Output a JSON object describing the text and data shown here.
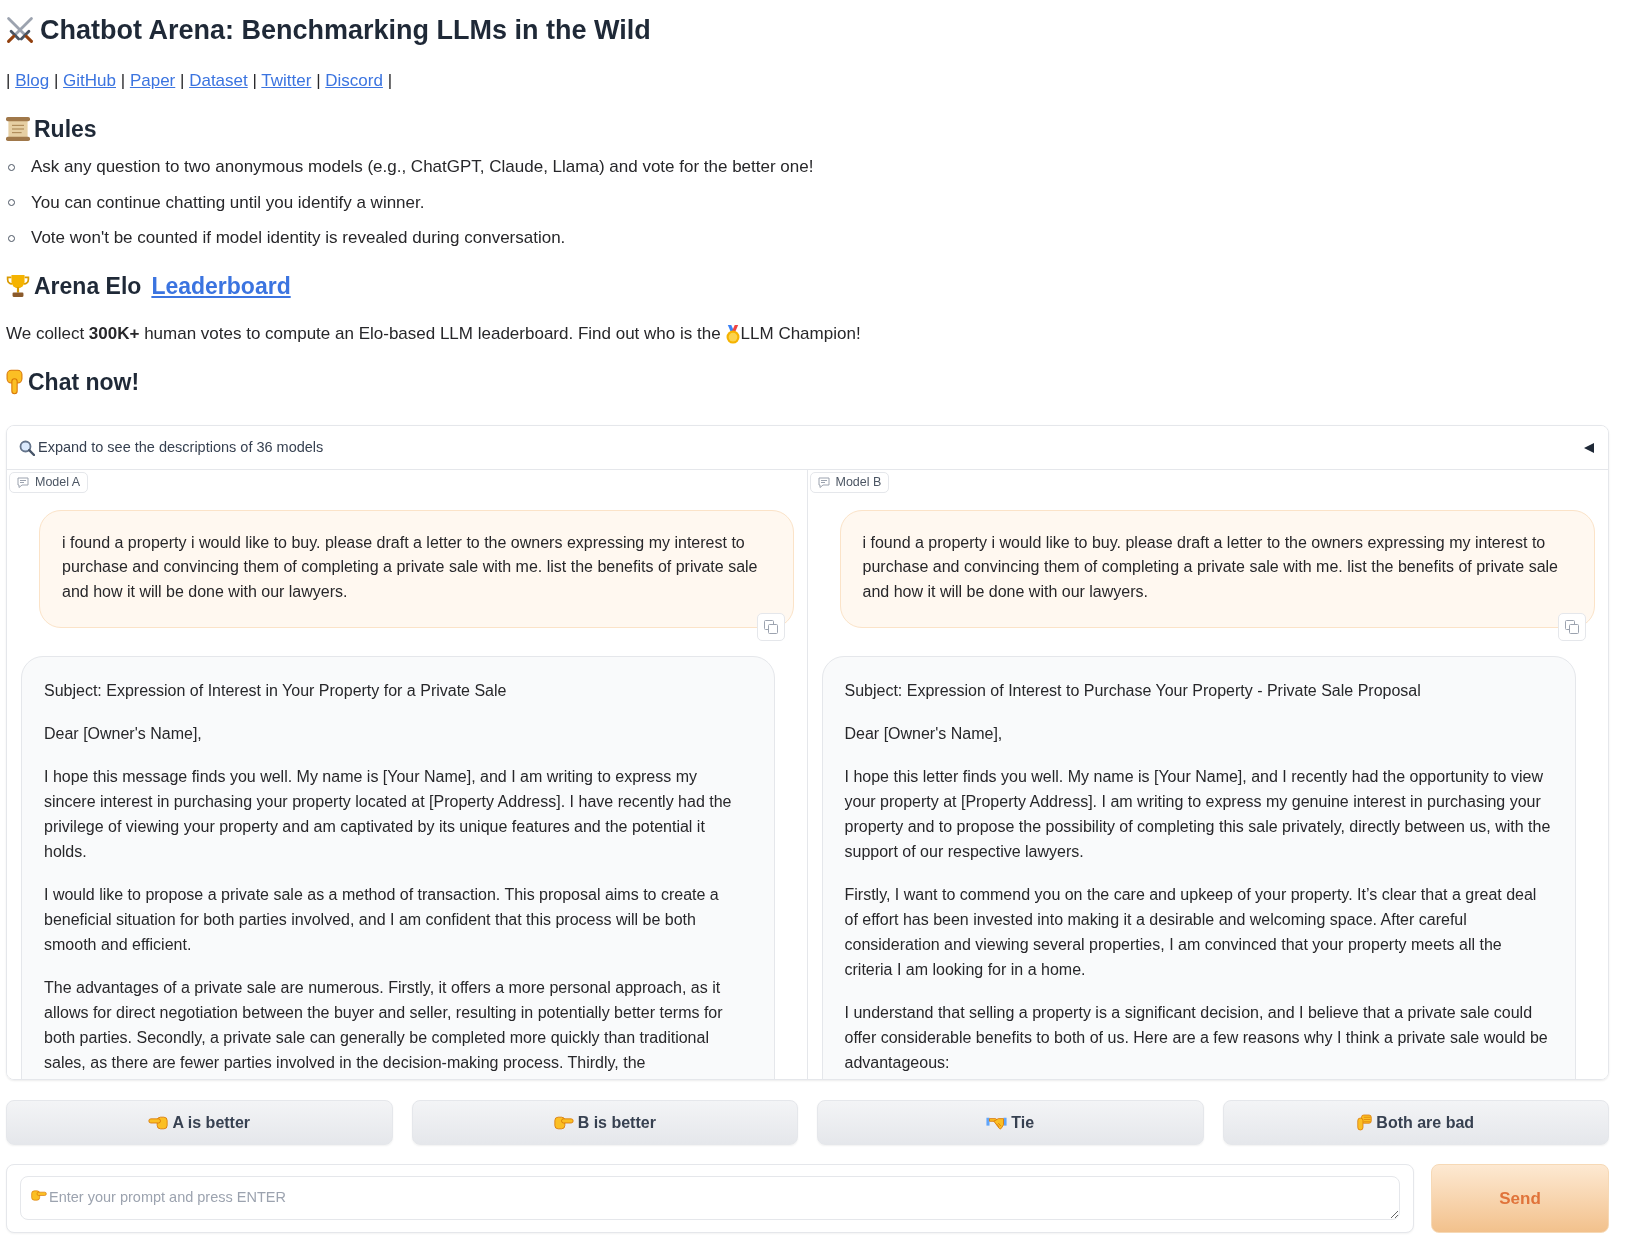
{
  "header": {
    "title": "Chatbot Arena: Benchmarking LLMs in the Wild"
  },
  "links_bar": {
    "separator": "|",
    "links": [
      "Blog",
      "GitHub",
      "Paper",
      "Dataset",
      "Twitter",
      "Discord"
    ]
  },
  "rules": {
    "heading": "Rules",
    "items": [
      "Ask any question to two anonymous models (e.g., ChatGPT, Claude, Llama) and vote for the better one!",
      "You can continue chatting until you identify a winner.",
      "Vote won't be counted if model identity is revealed during conversation."
    ]
  },
  "leaderboard": {
    "heading": "Arena Elo",
    "link": "Leaderboard",
    "text_before": "We collect **300K+** human votes to compute an Elo-based LLM leaderboard. Find out who is the",
    "text_after": "LLM Champion!"
  },
  "chat_heading": "Chat now!",
  "models_accordion": {
    "label": "Expand to see the descriptions of 36 models",
    "expanded": false
  },
  "chat_panels": [
    {
      "label": "Model A",
      "messages": [
        {
          "kind": "prompt",
          "paragraphs": [
            "i found a property i would like to buy. please draft a letter to the owners expressing my interest to purchase and convincing them of completing a private sale with me. list the benefits of private sale and how it will be done with our lawyers."
          ]
        },
        {
          "kind": "reply",
          "paragraphs": [
            "Subject: Expression of Interest in Your Property for a Private Sale",
            "Dear [Owner's Name],",
            "I hope this message finds you well. My name is [Your Name], and I am writing to express my sincere interest in purchasing your property located at [Property Address]. I have recently had the privilege of viewing your property and am captivated by its unique features and the potential it holds.",
            "I would like to propose a private sale as a method of transaction. This proposal aims to create a beneficial situation for both parties involved, and I am confident that this process will be both smooth and efficient.",
            "The advantages of a private sale are numerous. Firstly, it offers a more personal approach, as it allows for direct negotiation between the buyer and seller, resulting in potentially better terms for both parties. Secondly, a private sale can generally be completed more quickly than traditional sales, as there are fewer parties involved in the decision-making process. Thirdly, the"
          ]
        }
      ]
    },
    {
      "label": "Model B",
      "messages": [
        {
          "kind": "prompt",
          "paragraphs": [
            "i found a property i would like to buy. please draft a letter to the owners expressing my interest to purchase and convincing them of completing a private sale with me. list the benefits of private sale and how it will be done with our lawyers."
          ]
        },
        {
          "kind": "reply",
          "paragraphs": [
            "Subject: Expression of Interest to Purchase Your Property - Private Sale Proposal",
            "Dear [Owner's Name],",
            "I hope this letter finds you well. My name is [Your Name], and I recently had the opportunity to view your property at [Property Address]. I am writing to express my genuine interest in purchasing your property and to propose the possibility of completing this sale privately, directly between us, with the support of our respective lawyers.",
            "Firstly, I want to commend you on the care and upkeep of your property. It’s clear that a great deal of effort has been invested into making it a desirable and welcoming space. After careful consideration and viewing several properties, I am convinced that your property meets all the criteria I am looking for in a home.",
            "I understand that selling a property is a significant decision, and I believe that a private sale could offer considerable benefits to both of us. Here are a few reasons why I think a private sale would be advantageous:"
          ]
        }
      ]
    }
  ],
  "vote_buttons": [
    {
      "kind": "a",
      "label": "A is better"
    },
    {
      "kind": "b",
      "label": "B is better"
    },
    {
      "kind": "tie",
      "label": "Tie"
    },
    {
      "kind": "bad",
      "label": "Both are bad"
    }
  ],
  "prompt": {
    "placeholder": "Enter your prompt and press ENTER"
  },
  "send_button": "Send"
}
